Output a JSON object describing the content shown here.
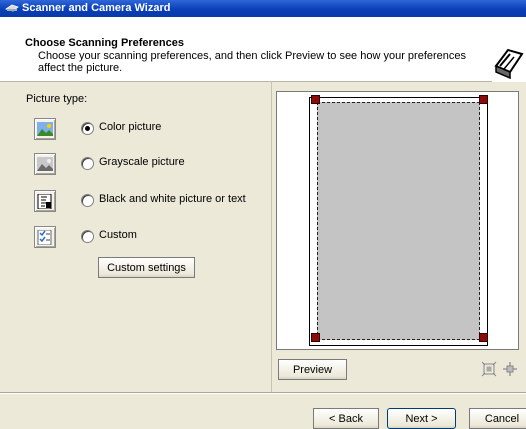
{
  "window": {
    "title": "Scanner and Camera Wizard",
    "app_icon": "scanner-app-icon"
  },
  "header": {
    "title": "Choose Scanning Preferences",
    "subtitle": "Choose your scanning preferences, and then click Preview to see how your preferences affect the picture.",
    "icon": "wizard-scanner-icon"
  },
  "picture_type": {
    "label": "Picture type:",
    "selected": "Color picture",
    "options": [
      {
        "label": "Color picture",
        "icon": "color-picture-icon",
        "checked": true
      },
      {
        "label": "Grayscale picture",
        "icon": "grayscale-picture-icon",
        "checked": false
      },
      {
        "label": "Black and white picture or text",
        "icon": "bw-text-icon",
        "checked": false
      },
      {
        "label": "Custom",
        "icon": "custom-settings-icon",
        "checked": false
      }
    ],
    "custom_settings_button": "Custom settings"
  },
  "preview": {
    "preview_button": "Preview",
    "tools": [
      "zoom-fit-icon",
      "zoom-selection-icon"
    ]
  },
  "nav": {
    "back": "< Back",
    "next": "Next >",
    "cancel": "Cancel"
  },
  "colors": {
    "titlebar": "#0a3fb8",
    "dialog_bg": "#ECE9D8",
    "scan_area": "#c4c4c4",
    "handle": "#8b0a0a"
  }
}
